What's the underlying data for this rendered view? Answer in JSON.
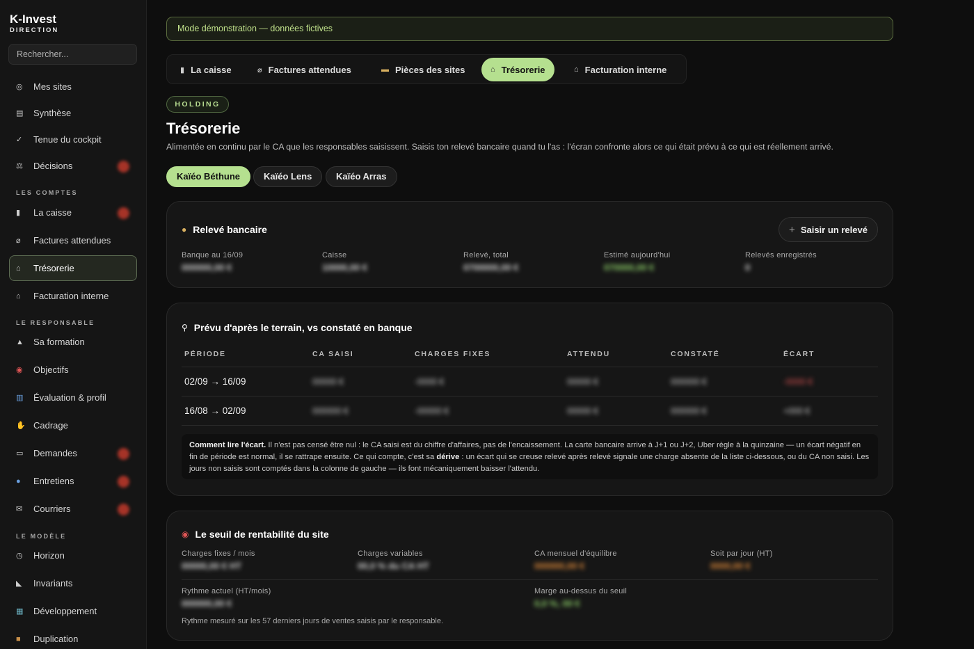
{
  "brand": {
    "name": "K-Invest",
    "sub": "DIRECTION"
  },
  "search": {
    "placeholder": "Rechercher..."
  },
  "sidebar": {
    "top": [
      {
        "label": "Mes sites"
      },
      {
        "label": "Synthèse"
      },
      {
        "label": "Tenue du cockpit"
      },
      {
        "label": "Décisions"
      }
    ],
    "comptes_title": "LES COMPTES",
    "comptes": [
      {
        "label": "La caisse"
      },
      {
        "label": "Factures attendues"
      },
      {
        "label": "Trésorerie"
      },
      {
        "label": "Facturation interne"
      }
    ],
    "responsable_title": "LE RESPONSABLE",
    "responsable": [
      {
        "label": "Sa formation"
      },
      {
        "label": "Objectifs"
      },
      {
        "label": "Évaluation & profil"
      },
      {
        "label": "Cadrage"
      },
      {
        "label": "Demandes"
      },
      {
        "label": "Entretiens"
      },
      {
        "label": "Courriers"
      }
    ],
    "modele_title": "LE MODÈLE",
    "modele": [
      {
        "label": "Horizon"
      },
      {
        "label": "Invariants"
      },
      {
        "label": "Développement"
      },
      {
        "label": "Duplication"
      }
    ]
  },
  "banner": "Mode démonstration — données fictives",
  "tabs": [
    {
      "label": "La caisse"
    },
    {
      "label": "Factures attendues"
    },
    {
      "label": "Pièces des sites"
    },
    {
      "label": "Trésorerie"
    },
    {
      "label": "Facturation interne"
    }
  ],
  "page": {
    "badge": "HOLDING",
    "title": "Trésorerie",
    "subtitle": "Alimentée en continu par le CA que les responsables saisissent. Saisis ton relevé bancaire quand tu l'as : l'écran confronte alors ce qui était prévu à ce qui est réellement arrivé."
  },
  "sites": [
    {
      "label": "Kaïéo Béthune"
    },
    {
      "label": "Kaïéo Lens"
    },
    {
      "label": "Kaïéo Arras"
    }
  ],
  "releve": {
    "title": "Relevé bancaire",
    "button": "Saisir un relevé",
    "stats": [
      {
        "label": "Banque au 16/09",
        "value": "000000,00 €"
      },
      {
        "label": "Caisse",
        "value": "10000,00 €"
      },
      {
        "label": "Relevé, total",
        "value": "0700000,00 €"
      },
      {
        "label": "Estimé aujourd'hui",
        "value": "070000,00 €"
      },
      {
        "label": "Relevés enregistrés",
        "value": "0"
      }
    ]
  },
  "prevu": {
    "title": "Prévu d'après le terrain, vs constaté en banque",
    "headers": [
      "PÉRIODE",
      "CA SAISI",
      "CHARGES FIXES",
      "ATTENDU",
      "CONSTATÉ",
      "ÉCART"
    ],
    "rows": [
      {
        "periode": "02/09 → 16/09",
        "ca": "00000 €",
        "charges": "-0000 €",
        "attendu": "00000 €",
        "constate": "000000 €",
        "ecart": "-0000 €"
      },
      {
        "periode": "16/08 → 02/09",
        "ca": "000000 €",
        "charges": "-00000 €",
        "attendu": "00000 €",
        "constate": "000000 €",
        "ecart": "+000 €"
      }
    ],
    "note_bold1": "Comment lire l'écart.",
    "note_text1": " Il n'est pas censé être nul : le CA saisi est du chiffre d'affaires, pas de l'encaissement. La carte bancaire arrive à J+1 ou J+2, Uber règle à la quinzaine — un écart négatif en fin de période est normal, il se rattrape ensuite. Ce qui compte, c'est sa ",
    "note_bold2": "dérive",
    "note_text2": " : un écart qui se creuse relevé après relevé signale une charge absente de la liste ci-dessous, ou du CA non saisi. Les jours non saisis sont comptés dans la colonne de gauche — ils font mécaniquement baisser l'attendu."
  },
  "seuil": {
    "title": "Le seuil de rentabilité du site",
    "stats": [
      {
        "label": "Charges fixes / mois",
        "value": "00000,00 € HT"
      },
      {
        "label": "Charges variables",
        "value": "00,0 % du CA HT"
      },
      {
        "label": "CA mensuel d'équilibre",
        "value": "000000,00 €"
      },
      {
        "label": "Soit par jour (HT)",
        "value": "0000,00 €"
      },
      {
        "label": "Rythme actuel (HT/mois)",
        "value": "000000,00 €"
      },
      {
        "label": "Marge au-dessus du seuil",
        "value": "0,0 %, 00 €"
      }
    ],
    "footnote": "Rythme mesuré sur les 57 derniers jours de ventes saisis par le responsable."
  }
}
